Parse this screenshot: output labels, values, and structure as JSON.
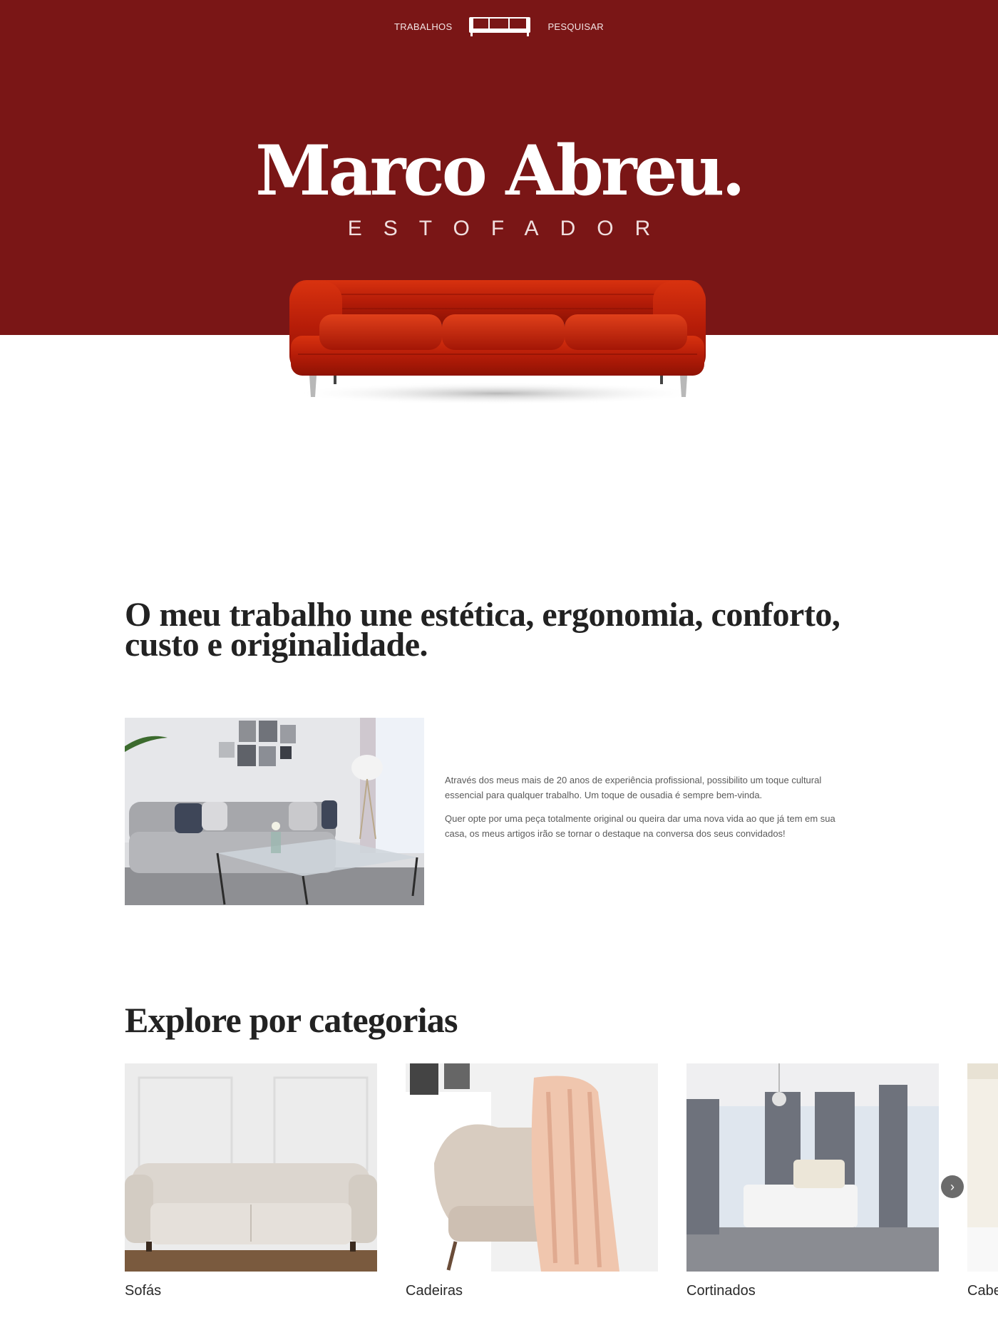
{
  "nav": {
    "left_link": "TRABALHOS",
    "right_link": "PESQUISAR",
    "logo_icon": "sofa-logo-icon"
  },
  "hero": {
    "title": "Marco Abreu.",
    "subtitle": "ESTOFADOR",
    "background_color": "#7a1616",
    "sofa_color": "#c41e0a"
  },
  "intro": {
    "heading": "O meu trabalho une estética, ergonomia, conforto, custo e originalidade.",
    "paragraphs": [
      "Através dos meus mais de 20 anos de experiência profissional, possibilito um toque cultural essencial para qualquer trabalho. Um toque de ousadia é sempre bem-vinda.",
      "Quer opte por uma peça totalmente original ou queira dar uma nova vida ao que já tem em sua casa, os meus artigos irão se tornar o destaque na conversa dos seus convidados!"
    ]
  },
  "categories": {
    "heading": "Explore por categorias",
    "items": [
      {
        "label": "Sofás"
      },
      {
        "label": "Cadeiras"
      },
      {
        "label": "Cortinados"
      },
      {
        "label": "Cabe"
      }
    ],
    "next_icon": "chevron-right-icon"
  }
}
